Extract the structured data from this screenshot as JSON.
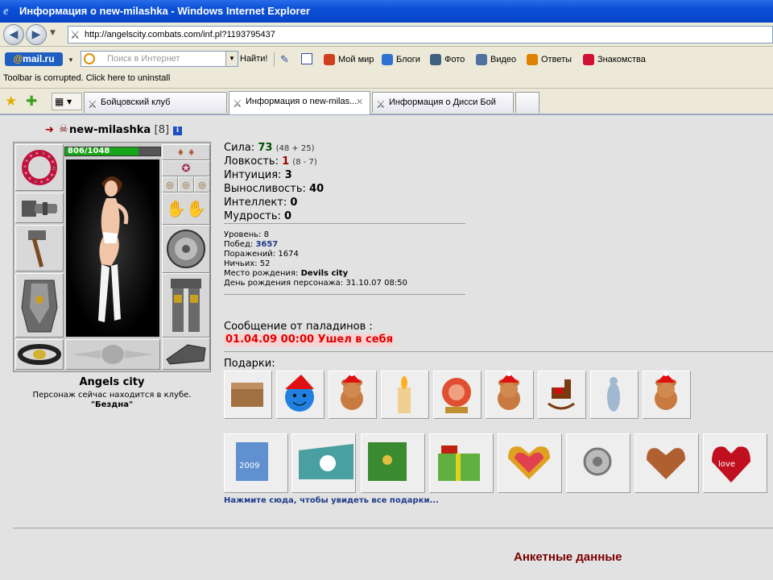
{
  "window": {
    "title": "Информация о new-milashka - Windows Internet Explorer"
  },
  "navbar": {
    "url": "http://angelscity.combats.com/inf.pl?1193795437",
    "back": "◀",
    "forward": "▶"
  },
  "mailbar": {
    "logo": "mail.ru",
    "search_placeholder": "Поиск в Интернет",
    "find_label": "Найти!",
    "items": [
      {
        "label": "Мой мир",
        "icon": "people-icon",
        "color": "#d04020"
      },
      {
        "label": "Блоги",
        "icon": "pencil-icon",
        "color": "#3070d0"
      },
      {
        "label": "Фото",
        "icon": "camera-icon",
        "color": "#406080"
      },
      {
        "label": "Видео",
        "icon": "video-icon",
        "color": "#5070a0"
      },
      {
        "label": "Ответы",
        "icon": "question-icon",
        "color": "#e08000"
      },
      {
        "label": "Знакомства",
        "icon": "heart-icon",
        "color": "#d01030"
      }
    ]
  },
  "corrupt_notice": "Toolbar is corrupted. Click here to uninstall",
  "tabs": [
    {
      "label": "Бойцовский клуб",
      "active": false
    },
    {
      "label": "Информация о new-milas...",
      "active": true
    },
    {
      "label": "Информация о Дисси Бой",
      "active": false
    }
  ],
  "character": {
    "name": "new-milashka",
    "level": "[8]",
    "hp_text": "806/1048",
    "hp_fraction": 0.77,
    "city": "Angels city",
    "location_text": "Персонаж сейчас находится в клубе.",
    "location_room": "\"Бездна\""
  },
  "stats": [
    {
      "label": "Сила:",
      "value": "73",
      "detail": "(48 + 25)",
      "color": "g"
    },
    {
      "label": "Ловкость:",
      "value": "1",
      "detail": "(8 - 7)",
      "color": "r"
    },
    {
      "label": "Интуиция:",
      "value": "3",
      "detail": "",
      "color": ""
    },
    {
      "label": "Выносливость:",
      "value": "40",
      "detail": "",
      "color": ""
    },
    {
      "label": "Интеллект:",
      "value": "0",
      "detail": "",
      "color": ""
    },
    {
      "label": "Мудрость:",
      "value": "0",
      "detail": "",
      "color": ""
    }
  ],
  "details": {
    "level_label": "Уровень:",
    "level": "8",
    "wins_label": "Побед:",
    "wins": "3657",
    "losses_label": "Поражений:",
    "losses": "1674",
    "draws_label": "Ничьих:",
    "draws": "52",
    "birthplace_label": "Место рождения:",
    "birthplace": "Devils city",
    "birthday_label": "День рождения персонажа:",
    "birthday": "31.10.07 08:50"
  },
  "paladin": {
    "header": "Сообщение от паладинов :",
    "message": "01.04.09 00:00 Ушел в себя"
  },
  "gifts": {
    "header": "Подарки:",
    "row1": [
      "box-gift-icon",
      "smiley-santa-icon",
      "teddy-bear-icon",
      "candle-icon",
      "crystal-ball-icon",
      "teddy-bear-icon",
      "rocking-horse-icon",
      "angel-statue-icon",
      "teddy-bear-icon"
    ],
    "row2": [
      "card-2009-icon",
      "card-2009-green-icon",
      "card-tree-2009-icon",
      "present-box-icon",
      "heart-gift-icon",
      "emblem-silver-icon",
      "heart-box-icon",
      "love-you-heart-icon"
    ],
    "see_all": "Нажмите сюда, чтобы увидеть все подарки..."
  },
  "anket_title": "Анкетные данные"
}
